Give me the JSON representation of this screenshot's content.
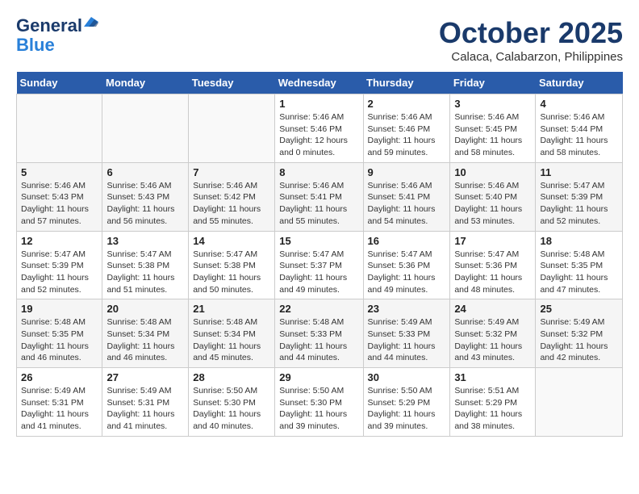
{
  "header": {
    "logo_line1": "General",
    "logo_line2": "Blue",
    "month": "October 2025",
    "location": "Calaca, Calabarzon, Philippines"
  },
  "weekdays": [
    "Sunday",
    "Monday",
    "Tuesday",
    "Wednesday",
    "Thursday",
    "Friday",
    "Saturday"
  ],
  "weeks": [
    [
      {
        "day": "",
        "info": ""
      },
      {
        "day": "",
        "info": ""
      },
      {
        "day": "",
        "info": ""
      },
      {
        "day": "1",
        "info": "Sunrise: 5:46 AM\nSunset: 5:46 PM\nDaylight: 12 hours\nand 0 minutes."
      },
      {
        "day": "2",
        "info": "Sunrise: 5:46 AM\nSunset: 5:46 PM\nDaylight: 11 hours\nand 59 minutes."
      },
      {
        "day": "3",
        "info": "Sunrise: 5:46 AM\nSunset: 5:45 PM\nDaylight: 11 hours\nand 58 minutes."
      },
      {
        "day": "4",
        "info": "Sunrise: 5:46 AM\nSunset: 5:44 PM\nDaylight: 11 hours\nand 58 minutes."
      }
    ],
    [
      {
        "day": "5",
        "info": "Sunrise: 5:46 AM\nSunset: 5:43 PM\nDaylight: 11 hours\nand 57 minutes."
      },
      {
        "day": "6",
        "info": "Sunrise: 5:46 AM\nSunset: 5:43 PM\nDaylight: 11 hours\nand 56 minutes."
      },
      {
        "day": "7",
        "info": "Sunrise: 5:46 AM\nSunset: 5:42 PM\nDaylight: 11 hours\nand 55 minutes."
      },
      {
        "day": "8",
        "info": "Sunrise: 5:46 AM\nSunset: 5:41 PM\nDaylight: 11 hours\nand 55 minutes."
      },
      {
        "day": "9",
        "info": "Sunrise: 5:46 AM\nSunset: 5:41 PM\nDaylight: 11 hours\nand 54 minutes."
      },
      {
        "day": "10",
        "info": "Sunrise: 5:46 AM\nSunset: 5:40 PM\nDaylight: 11 hours\nand 53 minutes."
      },
      {
        "day": "11",
        "info": "Sunrise: 5:47 AM\nSunset: 5:39 PM\nDaylight: 11 hours\nand 52 minutes."
      }
    ],
    [
      {
        "day": "12",
        "info": "Sunrise: 5:47 AM\nSunset: 5:39 PM\nDaylight: 11 hours\nand 52 minutes."
      },
      {
        "day": "13",
        "info": "Sunrise: 5:47 AM\nSunset: 5:38 PM\nDaylight: 11 hours\nand 51 minutes."
      },
      {
        "day": "14",
        "info": "Sunrise: 5:47 AM\nSunset: 5:38 PM\nDaylight: 11 hours\nand 50 minutes."
      },
      {
        "day": "15",
        "info": "Sunrise: 5:47 AM\nSunset: 5:37 PM\nDaylight: 11 hours\nand 49 minutes."
      },
      {
        "day": "16",
        "info": "Sunrise: 5:47 AM\nSunset: 5:36 PM\nDaylight: 11 hours\nand 49 minutes."
      },
      {
        "day": "17",
        "info": "Sunrise: 5:47 AM\nSunset: 5:36 PM\nDaylight: 11 hours\nand 48 minutes."
      },
      {
        "day": "18",
        "info": "Sunrise: 5:48 AM\nSunset: 5:35 PM\nDaylight: 11 hours\nand 47 minutes."
      }
    ],
    [
      {
        "day": "19",
        "info": "Sunrise: 5:48 AM\nSunset: 5:35 PM\nDaylight: 11 hours\nand 46 minutes."
      },
      {
        "day": "20",
        "info": "Sunrise: 5:48 AM\nSunset: 5:34 PM\nDaylight: 11 hours\nand 46 minutes."
      },
      {
        "day": "21",
        "info": "Sunrise: 5:48 AM\nSunset: 5:34 PM\nDaylight: 11 hours\nand 45 minutes."
      },
      {
        "day": "22",
        "info": "Sunrise: 5:48 AM\nSunset: 5:33 PM\nDaylight: 11 hours\nand 44 minutes."
      },
      {
        "day": "23",
        "info": "Sunrise: 5:49 AM\nSunset: 5:33 PM\nDaylight: 11 hours\nand 44 minutes."
      },
      {
        "day": "24",
        "info": "Sunrise: 5:49 AM\nSunset: 5:32 PM\nDaylight: 11 hours\nand 43 minutes."
      },
      {
        "day": "25",
        "info": "Sunrise: 5:49 AM\nSunset: 5:32 PM\nDaylight: 11 hours\nand 42 minutes."
      }
    ],
    [
      {
        "day": "26",
        "info": "Sunrise: 5:49 AM\nSunset: 5:31 PM\nDaylight: 11 hours\nand 41 minutes."
      },
      {
        "day": "27",
        "info": "Sunrise: 5:49 AM\nSunset: 5:31 PM\nDaylight: 11 hours\nand 41 minutes."
      },
      {
        "day": "28",
        "info": "Sunrise: 5:50 AM\nSunset: 5:30 PM\nDaylight: 11 hours\nand 40 minutes."
      },
      {
        "day": "29",
        "info": "Sunrise: 5:50 AM\nSunset: 5:30 PM\nDaylight: 11 hours\nand 39 minutes."
      },
      {
        "day": "30",
        "info": "Sunrise: 5:50 AM\nSunset: 5:29 PM\nDaylight: 11 hours\nand 39 minutes."
      },
      {
        "day": "31",
        "info": "Sunrise: 5:51 AM\nSunset: 5:29 PM\nDaylight: 11 hours\nand 38 minutes."
      },
      {
        "day": "",
        "info": ""
      }
    ]
  ]
}
